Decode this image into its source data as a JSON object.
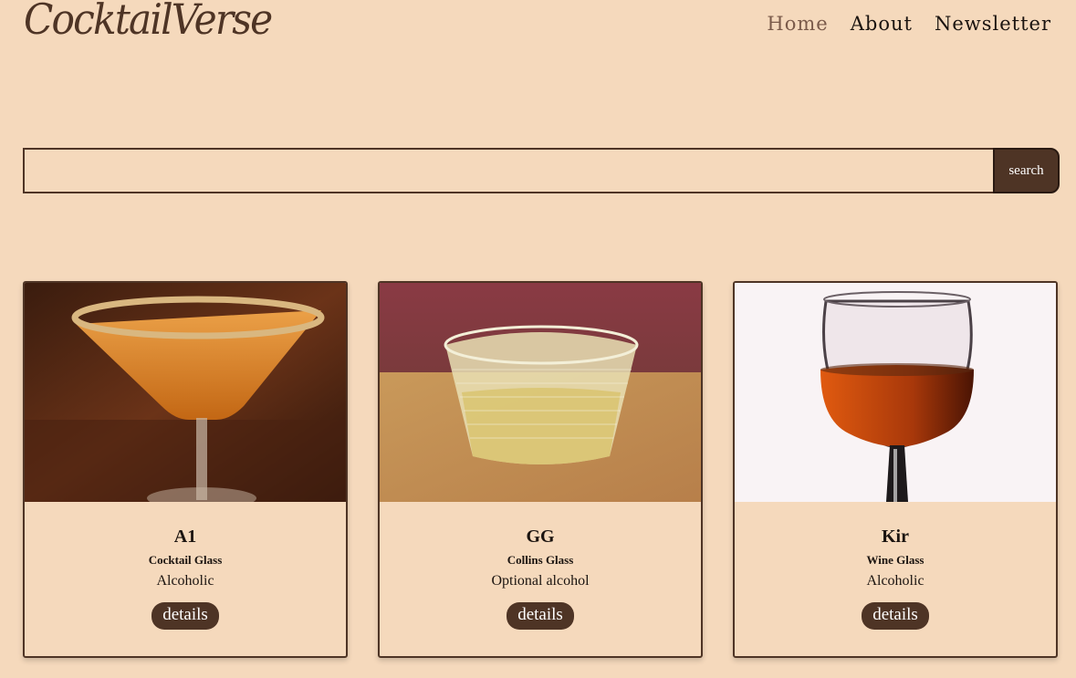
{
  "header": {
    "logo": "CocktailVerse",
    "nav": [
      "Home",
      "About",
      "Newsletter"
    ],
    "active_nav": "Home"
  },
  "search": {
    "value": "",
    "placeholder": "",
    "button_label": "search"
  },
  "cards": [
    {
      "name": "A1",
      "glass": "Cocktail Glass",
      "alcoholic": "Alcoholic",
      "button": "details",
      "image": "cocktail-glass-drink"
    },
    {
      "name": "GG",
      "glass": "Collins Glass",
      "alcoholic": "Optional alcohol",
      "button": "details",
      "image": "collins-glass-drink"
    },
    {
      "name": "Kir",
      "glass": "Wine Glass",
      "alcoholic": "Alcoholic",
      "button": "details",
      "image": "wine-glass-drink"
    }
  ],
  "colors": {
    "background": "#f5d9bc",
    "accent": "#4e3425",
    "nav_active": "#7a5a4a"
  }
}
